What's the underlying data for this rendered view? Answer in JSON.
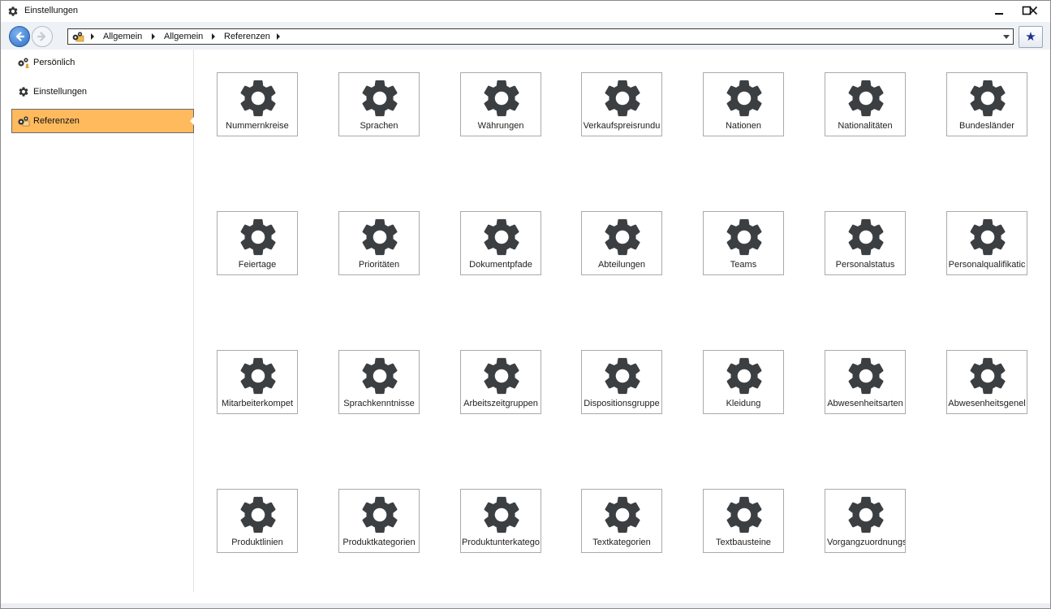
{
  "window": {
    "title": "Einstellungen",
    "title_icon": "gear-icon",
    "controls": [
      "minimize-icon",
      "maximize-icon",
      "close-icon"
    ]
  },
  "navigation": {
    "back_icon": "back-arrow-icon",
    "forward_icon": "forward-arrow-icon",
    "address_icon": "settings-folder-icon",
    "breadcrumb": [
      "Allgemein",
      "Allgemein",
      "Referenzen"
    ],
    "favorite_icon": "star-icon",
    "colors": {
      "back_button": "#2e6dc6",
      "favorite_star": "#1b2f8f"
    }
  },
  "sidebar": {
    "items": [
      {
        "label": "Persönlich",
        "icon": "gears-person-icon",
        "active": false
      },
      {
        "label": "Einstellungen",
        "icon": "gear-icon",
        "active": false
      },
      {
        "label": "Referenzen",
        "icon": "gears-folder-icon",
        "active": true
      }
    ],
    "active_color": "#ffba5e"
  },
  "tiles": [
    {
      "label": "Nummernkreise",
      "icon": "gear-icon"
    },
    {
      "label": "Sprachen",
      "icon": "gear-icon"
    },
    {
      "label": "Währungen",
      "icon": "gear-icon"
    },
    {
      "label": "Verkaufspreisrundu",
      "icon": "gear-icon"
    },
    {
      "label": "Nationen",
      "icon": "gear-icon"
    },
    {
      "label": "Nationalitäten",
      "icon": "gear-icon"
    },
    {
      "label": "Bundesländer",
      "icon": "gear-icon"
    },
    {
      "label": "Feiertage",
      "icon": "gear-icon"
    },
    {
      "label": "Prioritäten",
      "icon": "gear-icon"
    },
    {
      "label": "Dokumentpfade",
      "icon": "gear-icon"
    },
    {
      "label": "Abteilungen",
      "icon": "gear-icon"
    },
    {
      "label": "Teams",
      "icon": "gear-icon"
    },
    {
      "label": "Personalstatus",
      "icon": "gear-icon"
    },
    {
      "label": "Personalqualifikatic",
      "icon": "gear-icon"
    },
    {
      "label": "Mitarbeiterkompet",
      "icon": "gear-icon"
    },
    {
      "label": "Sprachkenntnisse",
      "icon": "gear-icon"
    },
    {
      "label": "Arbeitszeitgruppen",
      "icon": "gear-icon"
    },
    {
      "label": "Dispositionsgruppe",
      "icon": "gear-icon"
    },
    {
      "label": "Kleidung",
      "icon": "gear-icon"
    },
    {
      "label": "Abwesenheitsarten",
      "icon": "gear-icon"
    },
    {
      "label": "Abwesenheitsgenel",
      "icon": "gear-icon"
    },
    {
      "label": "Produktlinien",
      "icon": "gear-icon"
    },
    {
      "label": "Produktkategorien",
      "icon": "gear-icon"
    },
    {
      "label": "Produktunterkatego",
      "icon": "gear-icon"
    },
    {
      "label": "Textkategorien",
      "icon": "gear-icon"
    },
    {
      "label": "Textbausteine",
      "icon": "gear-icon"
    },
    {
      "label": "Vorgangzuordnungs",
      "icon": "gear-icon"
    }
  ],
  "tile_icon_color": "#3c3f42"
}
